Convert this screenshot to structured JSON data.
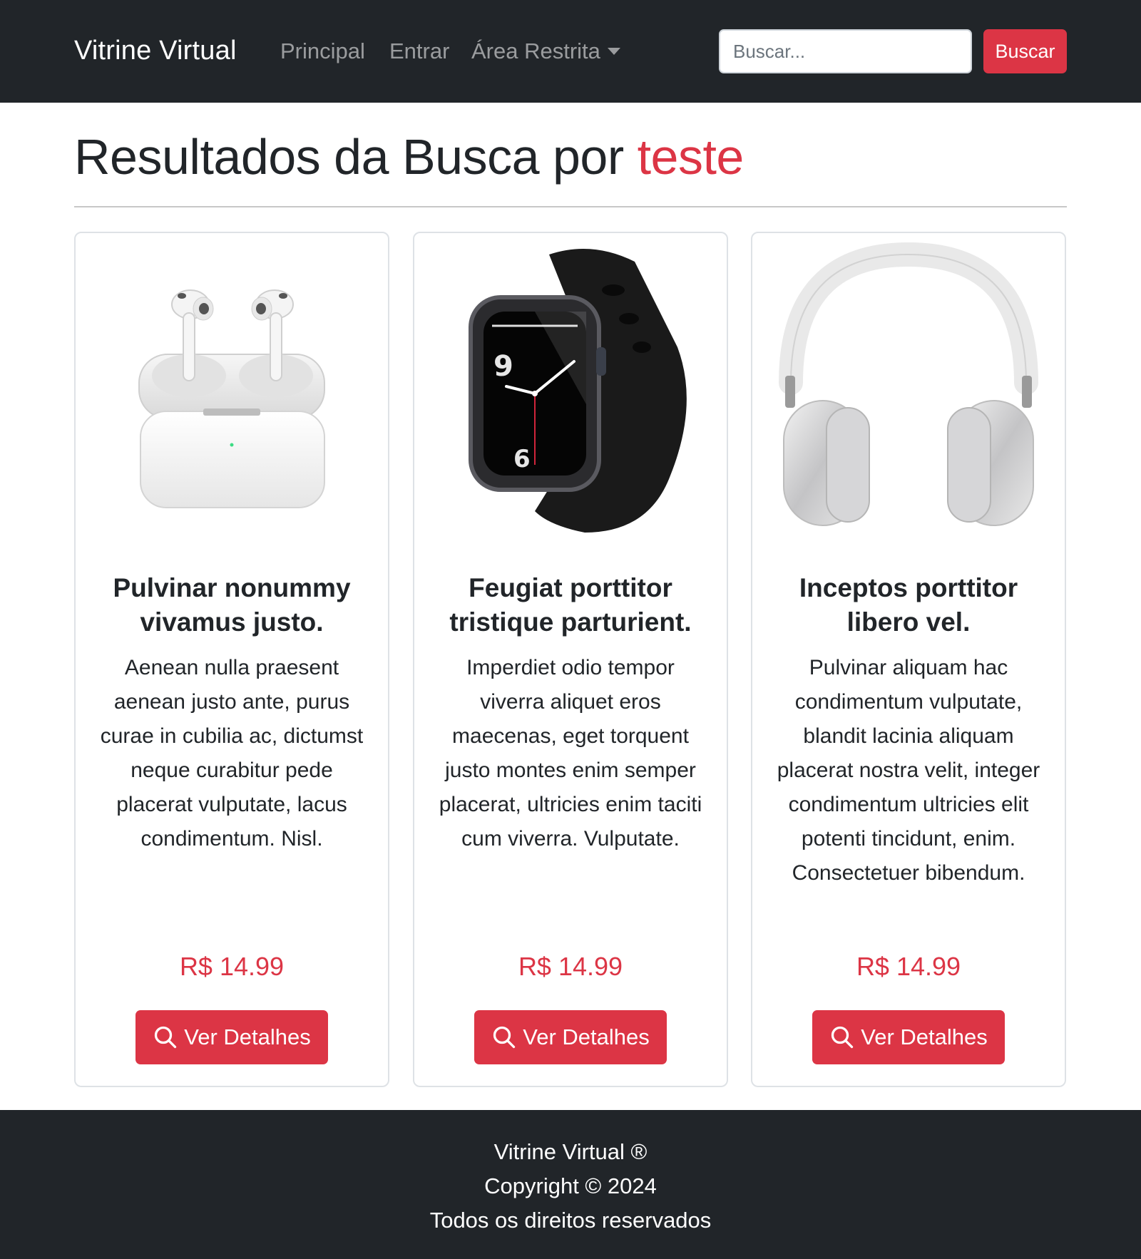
{
  "navbar": {
    "brand": "Vitrine Virtual",
    "links": [
      {
        "label": "Principal"
      },
      {
        "label": "Entrar"
      },
      {
        "label": "Área Restrita"
      }
    ],
    "search": {
      "placeholder": "Buscar...",
      "button_label": "Buscar"
    }
  },
  "page": {
    "heading_prefix": "Resultados da Busca por ",
    "query": "teste"
  },
  "products": [
    {
      "image": "airpods-icon",
      "title": "Pulvinar nonummy vivamus justo.",
      "description": "Aenean nulla praesent aenean justo ante, purus curae in cubilia ac, dictumst neque curabitur pede placerat vulputate, lacus condimentum. Nisl.",
      "price": "R$ 14.99",
      "button_label": "Ver Detalhes"
    },
    {
      "image": "smartwatch-icon",
      "title": "Feugiat porttitor tristique parturient.",
      "description": "Imperdiet odio tempor viverra aliquet eros maecenas, eget torquent justo montes enim semper placerat, ultricies enim taciti cum viverra. Vulputate.",
      "price": "R$ 14.99",
      "button_label": "Ver Detalhes"
    },
    {
      "image": "headphones-icon",
      "title": "Inceptos porttitor libero vel.",
      "description": "Pulvinar aliquam hac condimentum vulputate, blandit lacinia aliquam placerat nostra velit, integer condimentum ultricies elit potenti tincidunt, enim. Consectetuer bibendum.",
      "price": "R$ 14.99",
      "button_label": "Ver Detalhes"
    }
  ],
  "footer": {
    "line1": "Vitrine Virtual ®",
    "line2": "Copyright © 2024",
    "line3": "Todos os direitos reservados"
  },
  "colors": {
    "navbar_bg": "#212529",
    "accent": "#dc3545",
    "text": "#212529"
  }
}
